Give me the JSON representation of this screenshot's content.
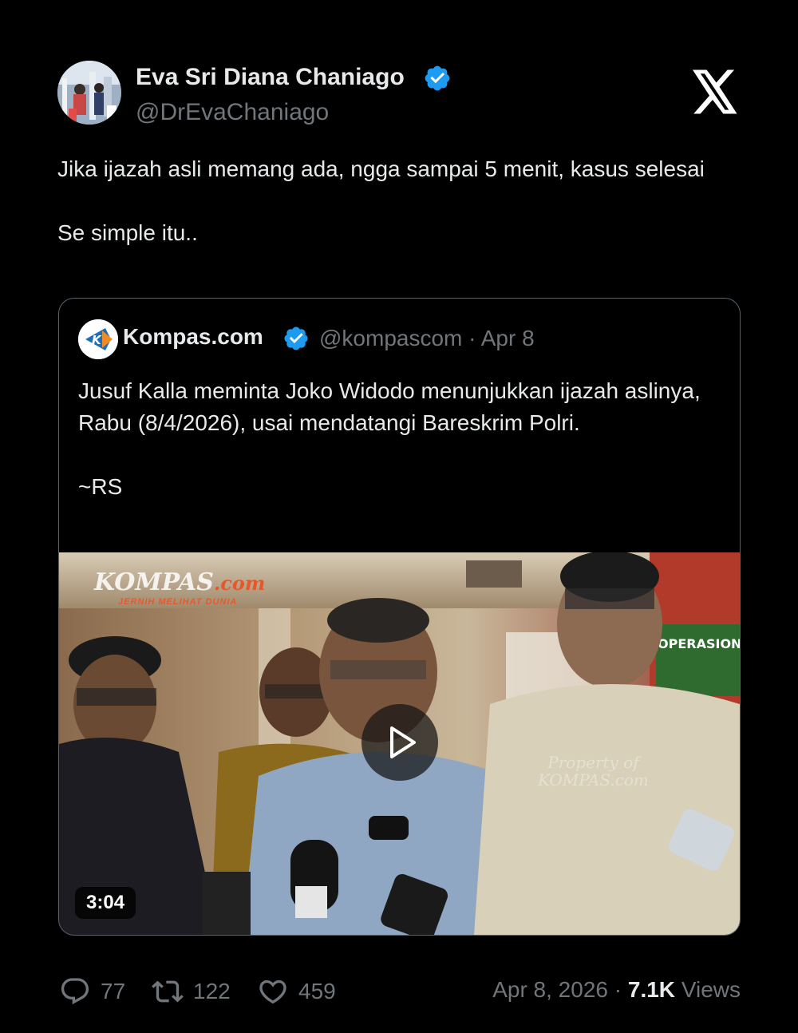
{
  "author": {
    "name": "Eva Sri Diana Chaniago",
    "handle": "@DrEvaChaniago"
  },
  "tweet_text": "Jika ijazah asli memang ada, ngga sampai 5 menit, kasus selesai\n\nSe simple itu..",
  "quoted": {
    "name": "Kompas.com",
    "handle": "@kompascom",
    "separator": "·",
    "date": "Apr 8",
    "text": "Jusuf Kalla meminta Joko Widodo menunjukkan ijazah aslinya, Rabu (8/4/2026), usai mendatangi Bareskrim Polri.\n\n~RS",
    "video": {
      "duration": "3:04",
      "watermark_logo": "KOMPAS",
      "watermark_logo_suffix": ".com",
      "watermark_tagline": "JERNIH MELIHAT DUNIA",
      "watermark_property_line1": "Property of",
      "watermark_property_line2": "KOMPAS.com",
      "sign_text": "OPERASIONAL"
    }
  },
  "stats": {
    "replies": "77",
    "reposts": "122",
    "likes": "459"
  },
  "footer": {
    "date": "Apr 8, 2026",
    "separator": "·",
    "views_count": "7.1K",
    "views_label": "Views"
  },
  "colors": {
    "background": "#000000",
    "primary_text": "#e7e9ea",
    "secondary_text": "#71767b",
    "verified_blue": "#1d9bf0",
    "card_border": "#536471"
  },
  "icons": [
    "verified-badge-icon",
    "x-logo-icon",
    "reply-icon",
    "repost-icon",
    "like-icon",
    "play-icon"
  ]
}
